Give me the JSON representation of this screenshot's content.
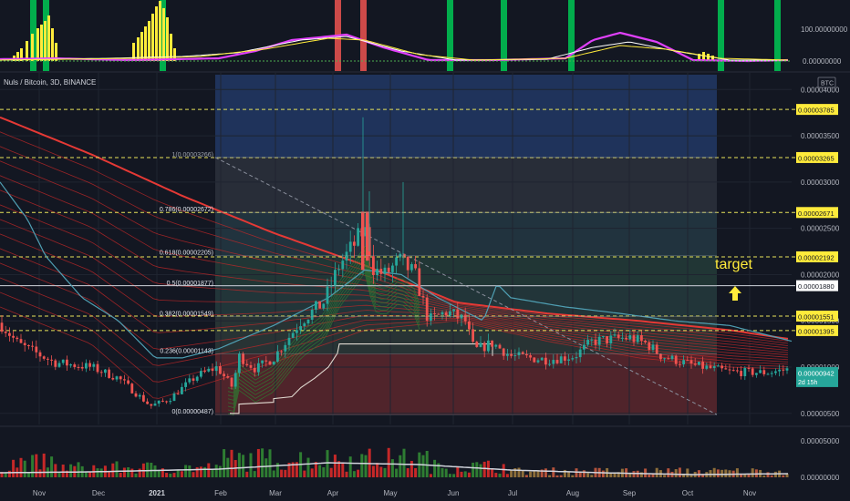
{
  "header": {
    "title": "Nuls / Bitcoin, 3D, BINANCE",
    "currency": "BTC"
  },
  "colors": {
    "bg": "#131722",
    "grid": "#1f2430",
    "text": "#b2b5be",
    "up": "#26a69a",
    "down": "#ef5350",
    "yellow": "#ffeb3b",
    "level_line": "#e8e35a",
    "ribbon": "#d32f2f",
    "label_bg": "#ffeb3b"
  },
  "main_axis": {
    "ylim": [
      3.8e-06,
      4.18e-05
    ],
    "ticks": [
      "0.00004000",
      "0.00003500",
      "0.00003000",
      "0.00002500",
      "0.00002000",
      "0.00001500",
      "0.00001000",
      "0.00000500"
    ],
    "tick_values": [
      4e-05,
      3.5e-05,
      3e-05,
      2.5e-05,
      2e-05,
      1.5e-05,
      1e-05,
      5e-06
    ]
  },
  "time_axis": {
    "labels": [
      "Nov",
      "Dec",
      "2021",
      "Feb",
      "Mar",
      "Apr",
      "May",
      "Jun",
      "Jul",
      "Aug",
      "Sep",
      "Oct",
      "Nov"
    ],
    "bold_label": "2021"
  },
  "top_panel": {
    "ticks": [
      "100.00000000",
      "0.00000000"
    ]
  },
  "volume_panel": {
    "ticks": [
      "0.00005000",
      "0.00000000"
    ]
  },
  "fib_levels": [
    {
      "label": "1(0.00003266)",
      "value": 3.266e-05
    },
    {
      "label": "0.786(0.00002672)",
      "value": 2.672e-05
    },
    {
      "label": "0.618(0.00002205)",
      "value": 2.205e-05
    },
    {
      "label": "0.5(0.00001877)",
      "value": 1.877e-05
    },
    {
      "label": "0.382(0.00001549)",
      "value": 1.549e-05
    },
    {
      "label": "0.236(0.00001143)",
      "value": 1.143e-05
    },
    {
      "label": "0(0.00000487)",
      "value": 4.87e-06
    }
  ],
  "price_labels": [
    {
      "text": "0.00003785",
      "value": 3.785e-05,
      "style": "yellow"
    },
    {
      "text": "0.00003265",
      "value": 3.265e-05,
      "style": "yellow"
    },
    {
      "text": "0.00002671",
      "value": 2.671e-05,
      "style": "yellow"
    },
    {
      "text": "0.00002192",
      "value": 2.192e-05,
      "style": "yellow"
    },
    {
      "text": "0.00001880",
      "value": 1.88e-05,
      "style": "white"
    },
    {
      "text": "0.00001551",
      "value": 1.551e-05,
      "style": "yellow"
    },
    {
      "text": "0.00001395",
      "value": 1.395e-05,
      "style": "yellow"
    }
  ],
  "current_price": {
    "text": "0.00000942",
    "countdown": "2d 15h",
    "value": 9.42e-06
  },
  "annotation": {
    "text": "target",
    "arrow": "up"
  },
  "chart_data": {
    "type": "candlestick",
    "ylim": [
      3.8e-06,
      4.18e-05
    ],
    "close_series_sample": [
      1.15e-05,
      1.02e-05,
      8.8e-06,
      7.2e-06,
      5.5e-06,
      6e-06,
      9.5e-06,
      1.12e-05,
      1.35e-05,
      1.6e-05,
      2.15e-05,
      2.45e-05,
      2.05e-05,
      2.1e-05,
      1.8e-05,
      1.6e-05,
      1.4e-05,
      1.15e-05,
      1.18e-05,
      1.2e-05,
      1.28e-05,
      1.32e-05,
      1.12e-05,
      9.8e-06,
      9.8e-06,
      9.4e-06
    ]
  }
}
